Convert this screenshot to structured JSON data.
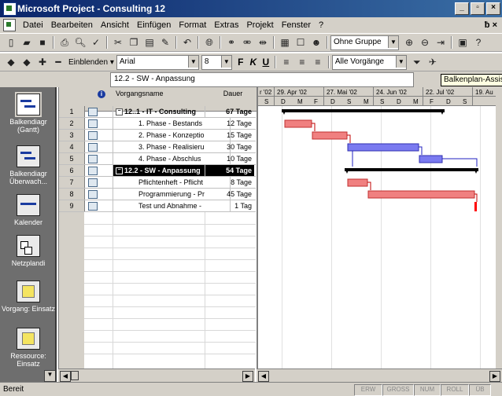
{
  "window": {
    "title": "Microsoft Project - Consulting 12",
    "minimize": "_",
    "restore": "▫",
    "close": "×"
  },
  "menu": {
    "items": [
      "Datei",
      "Bearbeiten",
      "Ansicht",
      "Einfügen",
      "Format",
      "Extras",
      "Projekt",
      "Fenster",
      "?"
    ],
    "doc_controls": "ƀ ×"
  },
  "toolbar1": {
    "group_combo": "Ohne Gruppe"
  },
  "toolbar2": {
    "show_label": "Einblenden ▾",
    "font": "Arial",
    "size": "8",
    "bold": "F",
    "italic": "K",
    "underline": "U",
    "filter": "Alle Vorgänge"
  },
  "tooltip": "Balkenplan-Assistent",
  "editbar": {
    "value": "12.2 - SW - Anpassung"
  },
  "viewbar": {
    "items": [
      {
        "label": "Balkendiagr (Gantt)",
        "icon": "gantt-icon"
      },
      {
        "label": "Balkendiagr Überwach...",
        "icon": "tracking-gantt-icon"
      },
      {
        "label": "Kalender",
        "icon": "calendar-icon"
      },
      {
        "label": "Netzplandi",
        "icon": "network-diagram-icon"
      },
      {
        "label": "Vorgang: Einsatz",
        "icon": "task-usage-icon"
      },
      {
        "label": "Ressource: Einsatz",
        "icon": "resource-usage-icon"
      }
    ]
  },
  "table": {
    "headers": {
      "info": "i",
      "name": "Vorgangsname",
      "duration": "Dauer"
    },
    "rows": [
      {
        "id": "1",
        "name": "12..1 - IT - Consulting",
        "duration": "67 Tage",
        "summary": true
      },
      {
        "id": "2",
        "name": "1. Phase - Bestands",
        "duration": "12 Tage"
      },
      {
        "id": "3",
        "name": "2. Phase - Konzeptio",
        "duration": "15 Tage"
      },
      {
        "id": "4",
        "name": "3. Phase - Realisieru",
        "duration": "30 Tage"
      },
      {
        "id": "5",
        "name": "4. Phase - Abschlus",
        "duration": "10 Tage"
      },
      {
        "id": "6",
        "name": "12.2 - SW - Anpassung",
        "duration": "54 Tage",
        "summary": true,
        "selected": true
      },
      {
        "id": "7",
        "name": "Pflichtenheft - Pflicht",
        "duration": "8 Tage"
      },
      {
        "id": "8",
        "name": "Programmierung - Pr",
        "duration": "45 Tage"
      },
      {
        "id": "9",
        "name": "Test und Abnahme -",
        "duration": "1 Tag"
      }
    ]
  },
  "gantt": {
    "timescale_major": [
      "r '02",
      "29. Apr '02",
      "27. Mai '02",
      "24. Jun '02",
      "22. Jul '02",
      "19. Au"
    ],
    "timescale_minor": [
      "S",
      "D",
      "M",
      "F",
      "D",
      "S",
      "M",
      "S",
      "D",
      "M",
      "F",
      "D",
      "S"
    ]
  },
  "status": {
    "text": "Bereit",
    "indicators": [
      "ERW",
      "GROSS",
      "NUM",
      "ROLL",
      "ÜB"
    ]
  }
}
